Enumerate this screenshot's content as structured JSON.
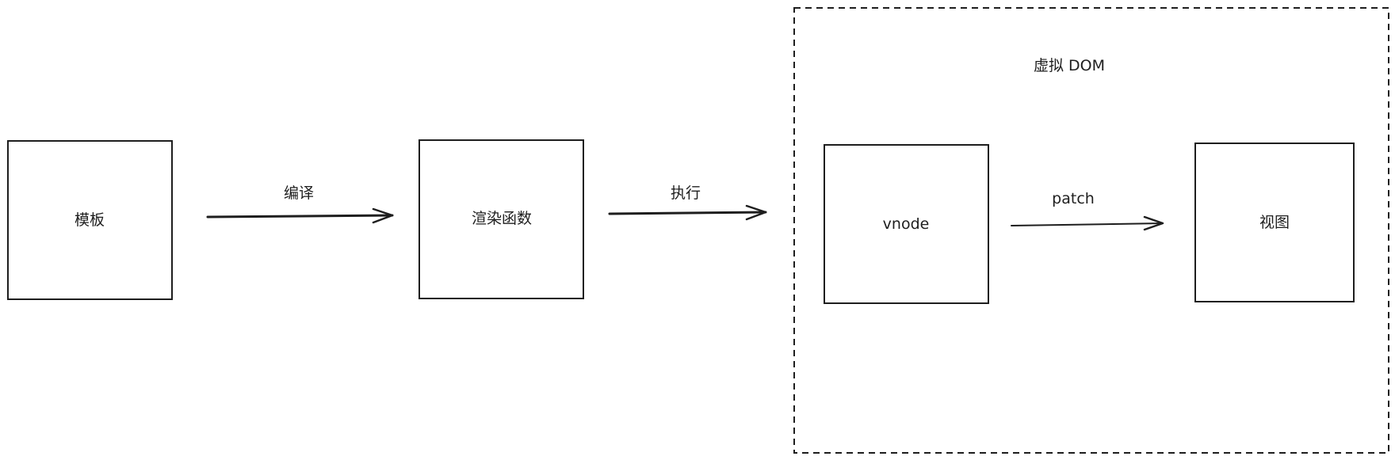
{
  "nodes": {
    "template": {
      "label": "模板"
    },
    "render_function": {
      "label": "渲染函数"
    },
    "vnode": {
      "label": "vnode"
    },
    "view": {
      "label": "视图"
    }
  },
  "group": {
    "virtual_dom": {
      "label": "虚拟 DOM"
    }
  },
  "edges": {
    "compile": {
      "label": "编译"
    },
    "execute": {
      "label": "执行"
    },
    "patch": {
      "label": "patch"
    }
  }
}
